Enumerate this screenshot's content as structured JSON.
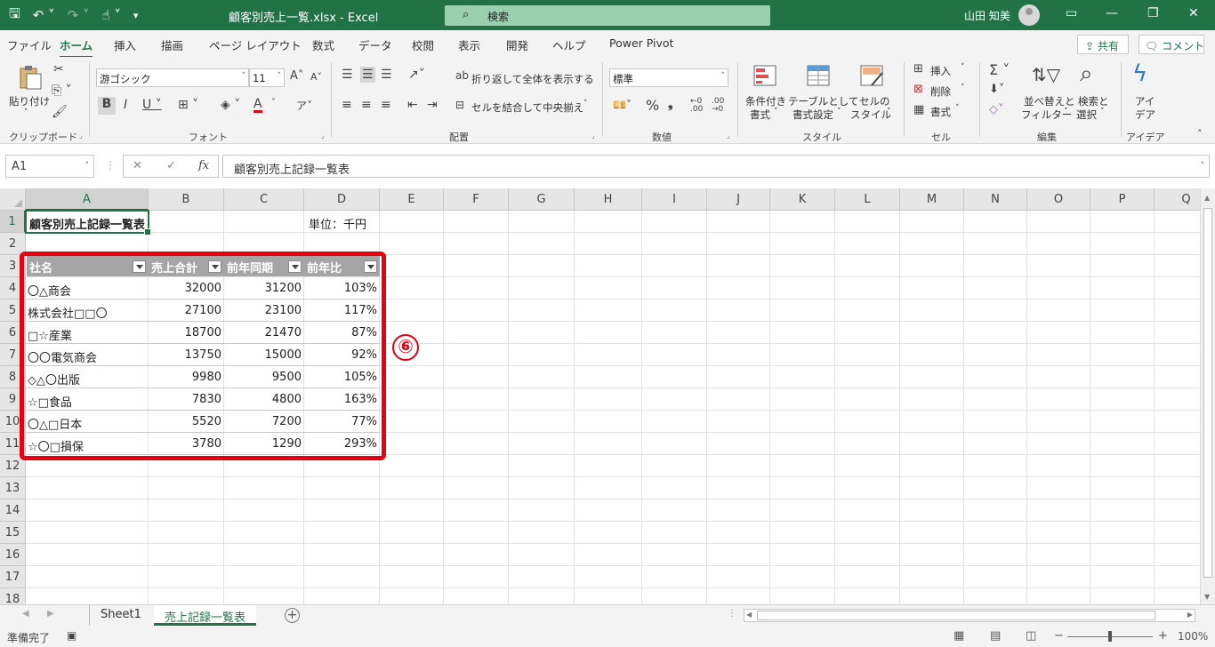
{
  "titlebar": {
    "filename": "顧客別売上一覧.xlsx",
    "app": "Excel",
    "search_placeholder": "検索",
    "user": "山田 知美"
  },
  "ribbon_tabs": [
    "ファイル",
    "ホーム",
    "挿入",
    "描画",
    "ページ レイアウト",
    "数式",
    "データ",
    "校閲",
    "表示",
    "開発",
    "ヘルプ",
    "Power Pivot"
  ],
  "share_label": "共有",
  "comment_label": "コメント",
  "ribbon": {
    "paste": "貼り付け",
    "font_name": "游ゴシック",
    "font_size": "11",
    "wrap_text": "折り返して全体を表示する",
    "merge_center": "セルを結合して中央揃え",
    "number_format": "標準",
    "conditional_format": [
      "条件付き",
      "書式"
    ],
    "format_as_table": [
      "テーブルとして",
      "書式設定"
    ],
    "cell_styles": [
      "セルの",
      "スタイル"
    ],
    "insert": "挿入",
    "delete": "削除",
    "format": "書式",
    "sort_filter": [
      "並べ替えと",
      "フィルター"
    ],
    "find_select": [
      "検索と",
      "選択"
    ],
    "ideas": [
      "アイ",
      "デア"
    ],
    "groups": {
      "clipboard": "クリップボード",
      "font": "フォント",
      "alignment": "配置",
      "number": "数値",
      "styles": "スタイル",
      "cells": "セル",
      "editing": "編集",
      "ideas": "アイデア"
    }
  },
  "formula_bar": {
    "name_box": "A1",
    "cancel": "✕",
    "enter": "✓",
    "fx": "fx",
    "formula": "顧客別売上記録一覧表"
  },
  "columns": [
    "A",
    "B",
    "C",
    "D",
    "E",
    "F",
    "G",
    "H",
    "I",
    "J",
    "K",
    "L",
    "M",
    "N",
    "O",
    "P",
    "Q"
  ],
  "rows": [
    "1",
    "2",
    "3",
    "4",
    "5",
    "6",
    "7",
    "8",
    "9",
    "10",
    "11",
    "12",
    "13",
    "14",
    "15",
    "16",
    "17",
    "18"
  ],
  "sheet": {
    "a1": "顧客別売上記録一覧表",
    "d1": "単位：千円",
    "table_headers": [
      "社名",
      "売上合計",
      "前年同期",
      "前年比"
    ],
    "table_rows": [
      [
        "〇△商会",
        "32000",
        "31200",
        "103%"
      ],
      [
        "株式会社□□〇",
        "27100",
        "23100",
        "117%"
      ],
      [
        "□☆産業",
        "18700",
        "21470",
        "87%"
      ],
      [
        "〇〇電気商会",
        "13750",
        "15000",
        "92%"
      ],
      [
        "◇△〇出版",
        "9980",
        "9500",
        "105%"
      ],
      [
        "☆□食品",
        "7830",
        "4800",
        "163%"
      ],
      [
        "〇△□日本",
        "5520",
        "7200",
        "77%"
      ],
      [
        "☆〇□損保",
        "3780",
        "1290",
        "293%"
      ]
    ]
  },
  "annotation": "⑥",
  "sheet_tabs": [
    "Sheet1",
    "売上記録一覧表"
  ],
  "status": {
    "ready": "準備完了",
    "zoom": "100%"
  },
  "colors": {
    "excel_green": "#217346",
    "table_header": "#a5a5a5",
    "highlight": "#e60012"
  }
}
